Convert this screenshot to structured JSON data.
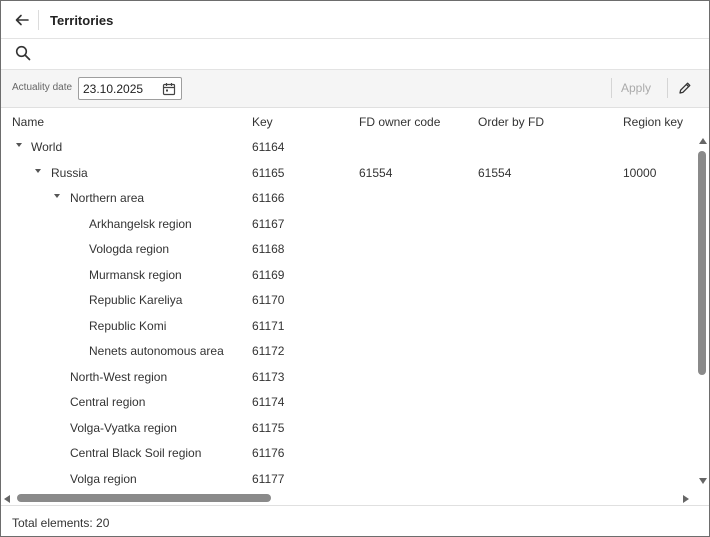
{
  "window": {
    "title": "Territories",
    "back_icon": "arrow-left-icon",
    "search_icon": "search-icon"
  },
  "toolbar": {
    "date_label": "Actuality date",
    "date_value": "23.10.2025",
    "calendar_icon": "calendar-icon",
    "apply_label": "Apply",
    "edit_icon": "pencil-icon"
  },
  "table": {
    "columns": [
      "Name",
      "Key",
      "FD owner code",
      "Order by FD",
      "Region key"
    ],
    "rows": [
      {
        "name": "World",
        "key": "61164",
        "fd_owner_code": "",
        "order_by_fd": "",
        "region_key": "",
        "level": 0,
        "expandable": true,
        "expanded": true
      },
      {
        "name": "Russia",
        "key": "61165",
        "fd_owner_code": "61554",
        "order_by_fd": "61554",
        "region_key": "10000",
        "level": 1,
        "expandable": true,
        "expanded": true
      },
      {
        "name": "Northern area",
        "key": "61166",
        "fd_owner_code": "",
        "order_by_fd": "",
        "region_key": "",
        "level": 2,
        "expandable": true,
        "expanded": true
      },
      {
        "name": "Arkhangelsk region",
        "key": "61167",
        "fd_owner_code": "",
        "order_by_fd": "",
        "region_key": "",
        "level": 3,
        "expandable": false
      },
      {
        "name": "Vologda region",
        "key": "61168",
        "fd_owner_code": "",
        "order_by_fd": "",
        "region_key": "",
        "level": 3,
        "expandable": false
      },
      {
        "name": "Murmansk region",
        "key": "61169",
        "fd_owner_code": "",
        "order_by_fd": "",
        "region_key": "",
        "level": 3,
        "expandable": false
      },
      {
        "name": "Republic Kareliya",
        "key": "61170",
        "fd_owner_code": "",
        "order_by_fd": "",
        "region_key": "",
        "level": 3,
        "expandable": false
      },
      {
        "name": "Republic Komi",
        "key": "61171",
        "fd_owner_code": "",
        "order_by_fd": "",
        "region_key": "",
        "level": 3,
        "expandable": false
      },
      {
        "name": "Nenets autonomous area",
        "key": "61172",
        "fd_owner_code": "",
        "order_by_fd": "",
        "region_key": "",
        "level": 3,
        "expandable": false
      },
      {
        "name": "North-West region",
        "key": "61173",
        "fd_owner_code": "",
        "order_by_fd": "",
        "region_key": "",
        "level": 2,
        "expandable": false
      },
      {
        "name": "Central region",
        "key": "61174",
        "fd_owner_code": "",
        "order_by_fd": "",
        "region_key": "",
        "level": 2,
        "expandable": false
      },
      {
        "name": "Volga-Vyatka region",
        "key": "61175",
        "fd_owner_code": "",
        "order_by_fd": "",
        "region_key": "",
        "level": 2,
        "expandable": false
      },
      {
        "name": "Central Black Soil region",
        "key": "61176",
        "fd_owner_code": "",
        "order_by_fd": "",
        "region_key": "",
        "level": 2,
        "expandable": false
      },
      {
        "name": "Volga region",
        "key": "61177",
        "fd_owner_code": "",
        "order_by_fd": "",
        "region_key": "",
        "level": 2,
        "expandable": false
      }
    ]
  },
  "footer": {
    "total_text": "Total elements: 20"
  }
}
